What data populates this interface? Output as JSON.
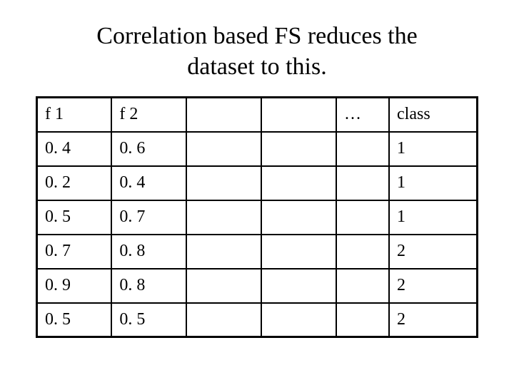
{
  "title_line1": "Correlation based FS reduces the",
  "title_line2": "dataset to this.",
  "chart_data": {
    "type": "table",
    "headers": [
      "f 1",
      "f 2",
      "",
      "",
      "…",
      "class"
    ],
    "rows": [
      [
        "0. 4",
        "0. 6",
        "",
        "",
        "",
        "1"
      ],
      [
        "0. 2",
        "0. 4",
        "",
        "",
        "",
        "1"
      ],
      [
        "0. 5",
        "0. 7",
        "",
        "",
        "",
        "1"
      ],
      [
        "0. 7",
        "0. 8",
        "",
        "",
        "",
        "2"
      ],
      [
        "0. 9",
        "0. 8",
        "",
        "",
        "",
        "2"
      ],
      [
        "0. 5",
        "0. 5",
        "",
        "",
        "",
        "2"
      ]
    ]
  }
}
